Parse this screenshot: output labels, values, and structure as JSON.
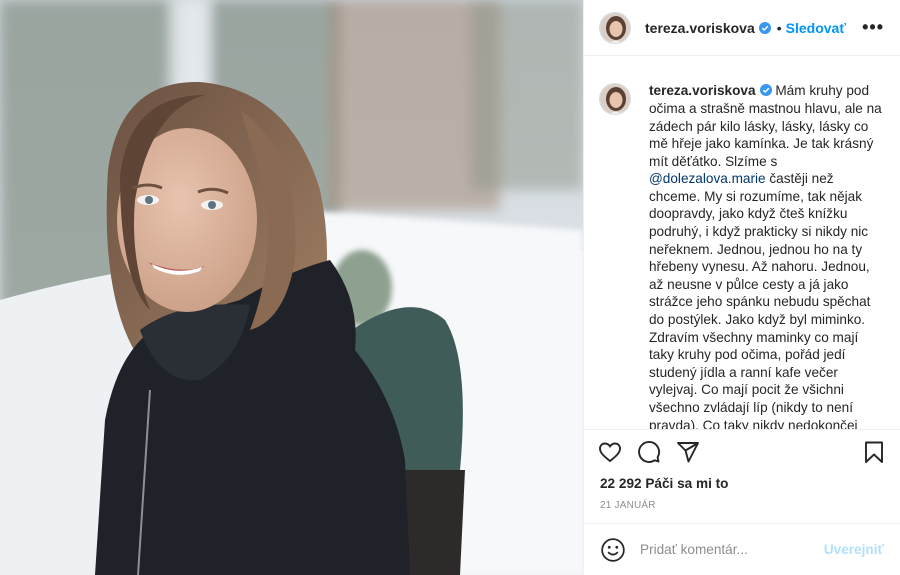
{
  "post": {
    "username": "tereza.voriskova",
    "follow_label": "Sledovať",
    "dot": "•",
    "more_label": "•••",
    "caption_username": "tereza.voriskova",
    "caption_part1": "Mám kruhy pod očima a strašně mastnou hlavu, ale na zádech pár kilo lásky, lásky, lásky co mě hřeje jako kamínka. Je tak krásný mít děťátko. Slzíme s ",
    "mention": "@dolezalova.marie",
    "caption_part2": " častěji než chceme. My si rozumíme, tak nějak doopravdy, jako když čteš knížku podruhý, i když prakticky si nikdy nic neřeknem. Jednou, jednou ho na ty hřebeny vynesu. Až nahoru. Jednou, až neusne v půlce cesty a já jako strážce jeho spánku nebudu spěchat do postýlek. Jako když byl miminko. Zdravím všechny maminky co mají taky kruhy pod očima, pořád jedí studený jídla a ranní kafe večer vylejvaj. Co mají pocit že všichni všechno zvládají líp (nikdy to není pravda). Co taky nikdy nedokončej žádnou práci, ani větu, ani",
    "likes": "22 292 Páči sa mi to",
    "date": "21 január",
    "comment_placeholder": "Pridať komentár...",
    "post_label": "Uverejniť"
  },
  "icons": {
    "like": "heart-icon",
    "comment": "comment-bubble-icon",
    "share": "paper-plane-icon",
    "save": "bookmark-icon",
    "emoji": "smiley-icon",
    "verified": "verified-badge-icon"
  },
  "colors": {
    "accent": "#0095f6",
    "mention": "#00376b",
    "muted": "#8e8e8e",
    "post_disabled": "#b2dffc"
  }
}
